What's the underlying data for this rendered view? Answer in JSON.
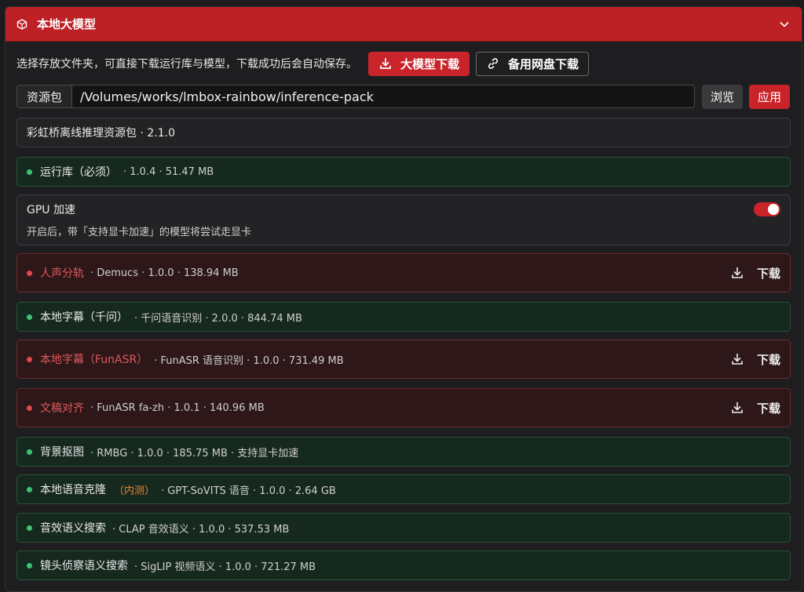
{
  "header": {
    "title": "本地大模型",
    "icon": "cube-icon",
    "collapse_icon": "chevron-down-icon"
  },
  "intro": {
    "description": "选择存放文件夹，可直接下载运行库与模型，下载成功后会自动保存。",
    "primary_download_label": "大模型下载",
    "backup_download_label": "备用网盘下载"
  },
  "path": {
    "label": "资源包",
    "value": "/Volumes/works/lmbox-rainbow/inference-pack",
    "browse_label": "浏览",
    "apply_label": "应用"
  },
  "pack_info": "彩虹桥离线推理资源包 · 2.1.0",
  "runtime": {
    "name": "运行库（必须）",
    "meta": "· 1.0.4 · 51.47 MB",
    "status": "installed"
  },
  "gpu": {
    "title": "GPU 加速",
    "description": "开启后，带「支持显卡加速」的模型将尝试走显卡",
    "enabled": true
  },
  "models": [
    {
      "name": "人声分轨",
      "meta": "· Demucs · 1.0.0 · 138.94 MB",
      "status": "missing",
      "action": "下载"
    },
    {
      "name": "本地字幕（千问）",
      "meta": "· 千问语音识别 · 2.0.0 · 844.74 MB",
      "status": "installed"
    },
    {
      "name": "本地字幕（FunASR）",
      "meta": "· FunASR 语音识别 · 1.0.0 · 731.49 MB",
      "status": "missing",
      "action": "下载"
    },
    {
      "name": "文稿对齐",
      "meta": "· FunASR fa-zh · 1.0.1 · 140.96 MB",
      "status": "missing",
      "action": "下载"
    },
    {
      "name": "背景抠图",
      "meta": "· RMBG · 1.0.0 · 185.75 MB · 支持显卡加速",
      "status": "installed"
    },
    {
      "name": "本地语音克隆",
      "badge": "（内测）",
      "meta": "· GPT-SoVITS 语音 · 1.0.0 · 2.64 GB",
      "status": "installed"
    },
    {
      "name": "音效语义搜索",
      "meta": "· CLAP 音效语义 · 1.0.0 · 537.53 MB",
      "status": "installed"
    },
    {
      "name": "镜头侦察语义搜索",
      "meta": "· SigLIP 视频语义 · 1.0.0 · 721.27 MB",
      "status": "installed"
    }
  ],
  "colors": {
    "accent": "#c8242a",
    "installed_dot": "#3fc373",
    "missing_dot": "#e0474c",
    "beta_text": "#e7862f"
  }
}
